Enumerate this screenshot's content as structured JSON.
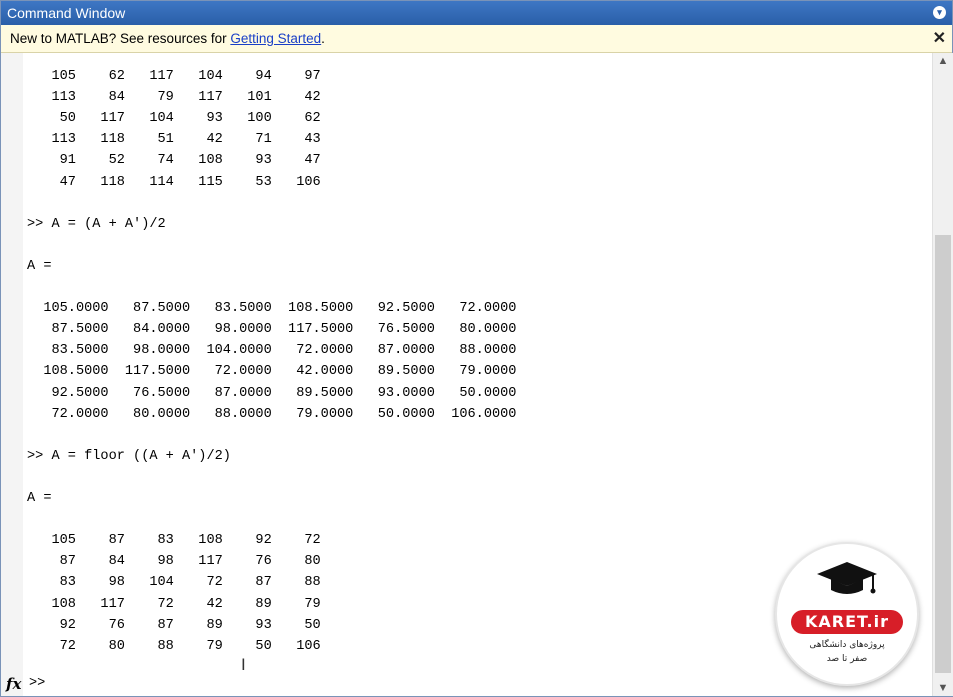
{
  "window": {
    "title": "Command Window",
    "menu_icon": "chevron-down-circle-icon",
    "close_icon": "close-icon"
  },
  "infobar": {
    "text": "New to MATLAB? See resources for ",
    "link": "Getting Started",
    "suffix": "."
  },
  "console": {
    "lines": [
      "   105    62   117   104    94    97",
      "   113    84    79   117   101    42",
      "    50   117   104    93   100    62",
      "   113   118    51    42    71    43",
      "    91    52    74   108    93    47",
      "    47   118   114   115    53   106",
      "",
      ">> A = (A + A')/2",
      "",
      "A =",
      "",
      "  105.0000   87.5000   83.5000  108.5000   92.5000   72.0000",
      "   87.5000   84.0000   98.0000  117.5000   76.5000   80.0000",
      "   83.5000   98.0000  104.0000   72.0000   87.0000   88.0000",
      "  108.5000  117.5000   72.0000   42.0000   89.5000   79.0000",
      "   92.5000   76.5000   87.0000   89.5000   93.0000   50.0000",
      "   72.0000   80.0000   88.0000   79.0000   50.0000  106.0000",
      "",
      ">> A = floor ((A + A')/2)",
      "",
      "A =",
      "",
      "   105    87    83   108    92    72",
      "    87    84    98   117    76    80",
      "    83    98   104    72    87    88",
      "   108   117    72    42    89    79",
      "    92    76    87    89    93    50",
      "    72    80    88    79    50   106"
    ],
    "fx_label": "fx",
    "prompt": ">>"
  },
  "watermark": {
    "brand": "KARET.ir",
    "line1": "پروژه‌های دانشگاهی",
    "line2": "صفر تا صد",
    "icon": "graduation-cap-icon",
    "accent": "#d71e28"
  },
  "colors": {
    "titlebar": "#2a5ea8",
    "infobar_bg": "#fffbe0",
    "link": "#1a3fc7"
  }
}
